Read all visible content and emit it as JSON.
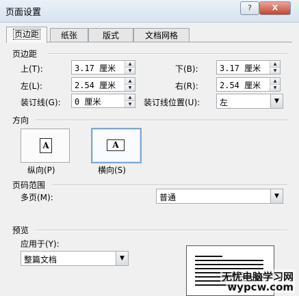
{
  "window": {
    "title": "页面设置",
    "help_label": "?",
    "close_label": "X"
  },
  "tabs": [
    {
      "label": "页边距"
    },
    {
      "label": "纸张"
    },
    {
      "label": "版式"
    },
    {
      "label": "文档网格"
    }
  ],
  "margins": {
    "section_label": "页边距",
    "top_label": "上(T):",
    "top_value": "3.17 厘米",
    "bottom_label": "下(B):",
    "bottom_value": "3.17 厘米",
    "left_label": "左(L):",
    "left_value": "2.54 厘米",
    "right_label": "右(R):",
    "right_value": "2.54 厘米",
    "gutter_label": "装订线(G):",
    "gutter_value": "0 厘米",
    "gutter_pos_label": "装订线位置(U):",
    "gutter_pos_value": "左"
  },
  "orientation": {
    "section_label": "方向",
    "portrait_label": "纵向(P)",
    "landscape_label": "横向(S)",
    "icon_letter": "A",
    "selected": "landscape"
  },
  "pages": {
    "section_label": "页码范围",
    "multiple_label": "多页(M):",
    "multiple_value": "普通"
  },
  "preview": {
    "section_label": "预览",
    "apply_label": "应用于(Y):",
    "apply_value": "整篇文档"
  },
  "watermark": {
    "line1": "无忧电脑学习网",
    "line2": "wypcw.com"
  }
}
